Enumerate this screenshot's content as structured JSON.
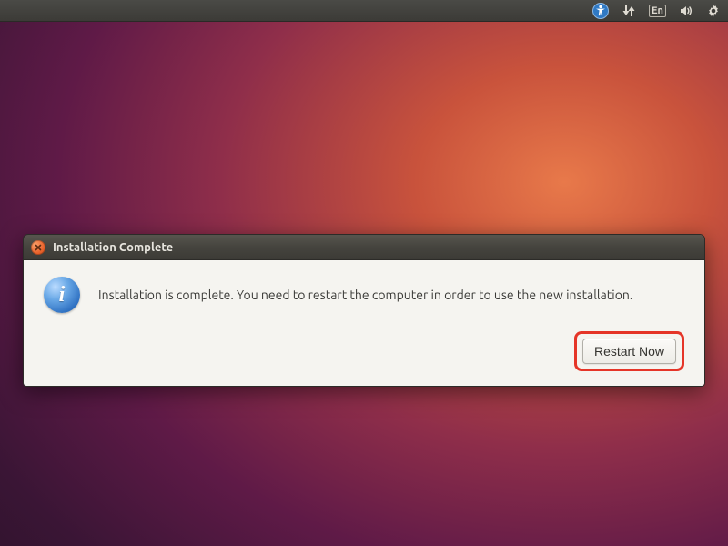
{
  "panel": {
    "language_indicator": "En"
  },
  "dialog": {
    "title": "Installation Complete",
    "info_glyph": "i",
    "message": "Installation is complete. You need to restart the computer in order to use the new installation.",
    "restart_button": "Restart Now"
  }
}
